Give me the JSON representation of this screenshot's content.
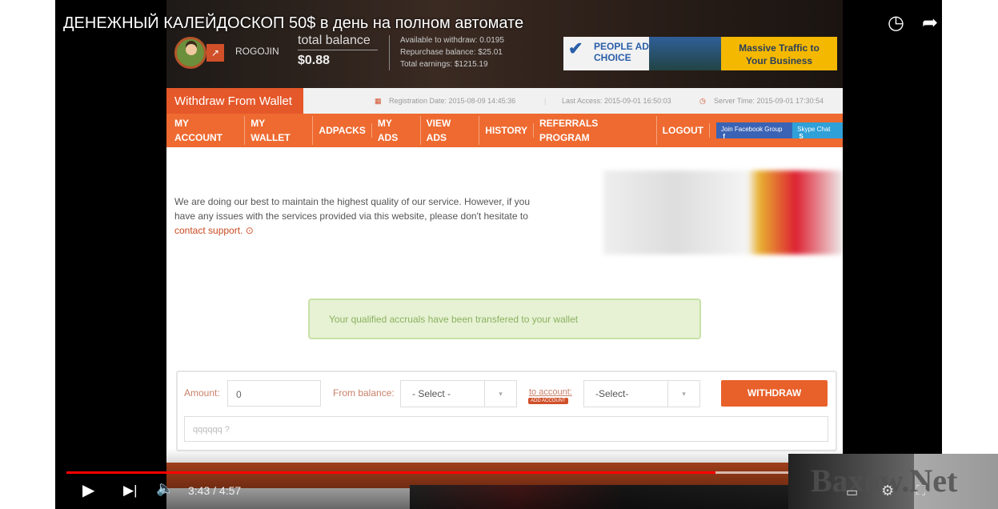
{
  "video": {
    "title": "ДЕНЕЖНЫЙ КАЛЕЙДОСКОП 50$ в день на полном автомате",
    "current_time": "3:43",
    "duration": "4:57",
    "played_fraction": 0.751,
    "buffered_fraction": 0.99
  },
  "site": {
    "username": "ROGOJIN",
    "total_balance_label": "total balance",
    "total_balance": "$0.88",
    "available": "Available to withdraw: 0.0195",
    "repurchase": "Repurchase balance: $25.01",
    "total_earnings": "Total earnings: $1215.19",
    "banner": {
      "brand_line1": "PEOPLE AD",
      "brand_line2": "CHOICE",
      "slogan_line1": "Massive Traffic to",
      "slogan_line2": "Your Business"
    },
    "page_title": "Withdraw From Wallet",
    "registration": "Registration Date: 2015-08-09 14:45:36",
    "last_access": "Last Access: 2015-09-01 16:50:03",
    "server_time": "Server Time: 2015-09-01 17:30:54",
    "nav": [
      "MY ACCOUNT",
      "MY WALLET",
      "ADPACKS",
      "MY ADS",
      "VIEW ADS",
      "HISTORY",
      "REFERRALS PROGRAM",
      "LOGOUT"
    ],
    "facebook": "Join Facebook Group",
    "skype": "Skype Chat",
    "notice": "We are doing our best to maintain the highest quality of our service. However, if you have any issues with the services provided via this website, please don't hesitate to",
    "notice_link": "contact support.",
    "alert": "Your qualified accruals have been transfered to your wallet",
    "form": {
      "amount_label": "Amount:",
      "amount_value": "0",
      "from_label": "From balance:",
      "from_value": "- Select -",
      "to_label": "to account:",
      "add_account": "ADD ACCOUNT",
      "to_value": "-Select-",
      "withdraw": "WITHDRAW",
      "question_placeholder": "qqqqqq ?"
    }
  },
  "watermark": "Baxow.Net",
  "colors": {
    "accent": "#ee6a30",
    "progress": "#ff0000"
  }
}
